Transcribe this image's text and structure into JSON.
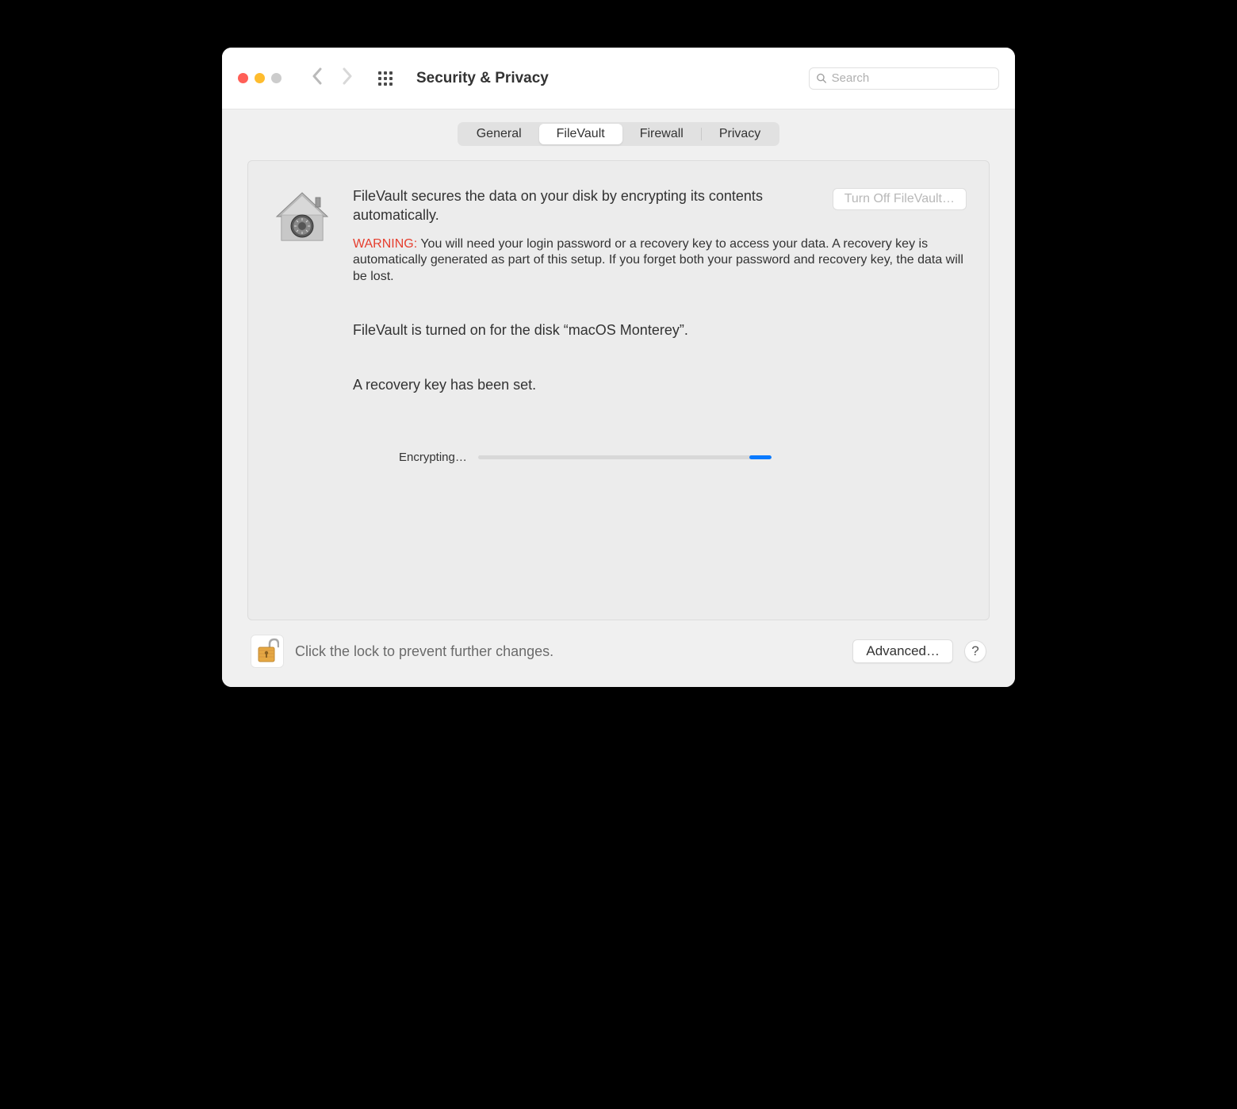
{
  "window": {
    "title": "Security & Privacy"
  },
  "search": {
    "placeholder": "Search"
  },
  "tabs": {
    "general": "General",
    "filevault": "FileVault",
    "firewall": "Firewall",
    "privacy": "Privacy"
  },
  "panel": {
    "intro": "FileVault secures the data on your disk by encrypting its contents automatically.",
    "turn_off_label": "Turn Off FileVault…",
    "warning_label": "WARNING:",
    "warning_body": " You will need your login password or a recovery key to access your data. A recovery key is automatically generated as part of this setup. If you forget both your password and recovery key, the data will be lost.",
    "status": "FileVault is turned on for the disk “macOS Monterey”.",
    "recovery": "A recovery key has been set.",
    "progress_label": "Encrypting…"
  },
  "footer": {
    "lock_text": "Click the lock to prevent further changes.",
    "advanced_label": "Advanced…",
    "help_label": "?"
  }
}
